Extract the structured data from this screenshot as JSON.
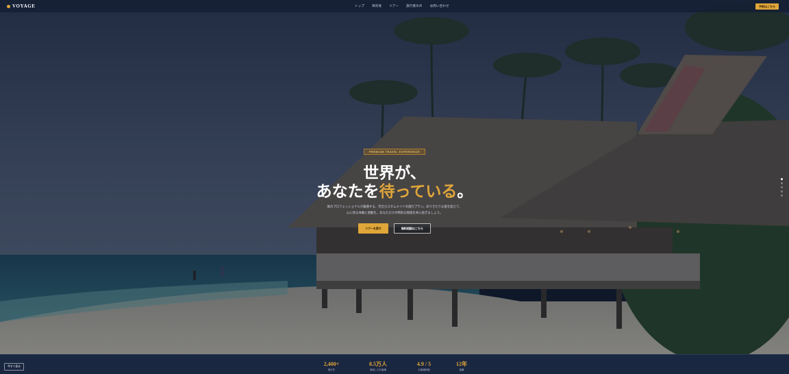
{
  "nav": {
    "logo": "VOYAGE",
    "menu": [
      "トップ",
      "目的地",
      "ツアー",
      "旅行者の声",
      "お問い合わせ"
    ],
    "cta": "予約はこちら"
  },
  "hero": {
    "eyebrow": "PREMIUM TRAVEL EXPERIENCE",
    "headline_line1": "世界が、",
    "headline_line2_pre": "あなたを",
    "headline_line2_accent": "待っている",
    "headline_line2_post": "。",
    "subtitle_line1": "旅のプロフェッショナルが厳選する、完全カスタムメイドの旅行プラン。ありきたりな旅を超えて、",
    "subtitle_line2": "心に残る体験と感動を。あなただけの特別な物語を共に紡ぎましょう。",
    "primary_button": "ツアーを探す",
    "secondary_button": "無料相談はこちら",
    "slide_count": 5,
    "active_slide": 1
  },
  "stats": {
    "left_label": "今すぐ見る",
    "items": [
      {
        "value": "2,400+",
        "label": "旅行先"
      },
      {
        "value": "8.5万人",
        "label": "満足したお客様"
      },
      {
        "value": "4.9 / 5",
        "label": "お客様評価"
      },
      {
        "value": "12年",
        "label": "実績"
      }
    ]
  },
  "colors": {
    "accent": "#e0a63a",
    "nav_bg": "#141e34",
    "stats_bg": "#1a2740"
  }
}
